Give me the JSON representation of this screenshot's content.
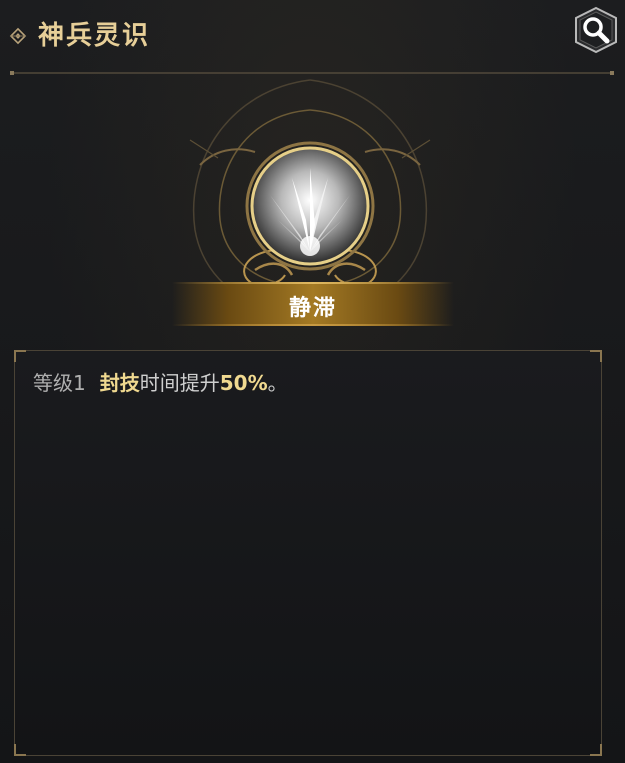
{
  "header": {
    "title": "神兵灵识"
  },
  "skill": {
    "name": "静滞"
  },
  "description": {
    "level": "等级1",
    "highlight": "封技",
    "text": "时间提升",
    "value": "50%",
    "suffix": "。"
  },
  "colors": {
    "gold": "#e7cf98",
    "highlight": "#f0d990",
    "background": "#18191b"
  },
  "icons": {
    "title": "ornament-diamond-icon",
    "search": "magnifier-icon",
    "skill": "blades-burst-icon"
  }
}
